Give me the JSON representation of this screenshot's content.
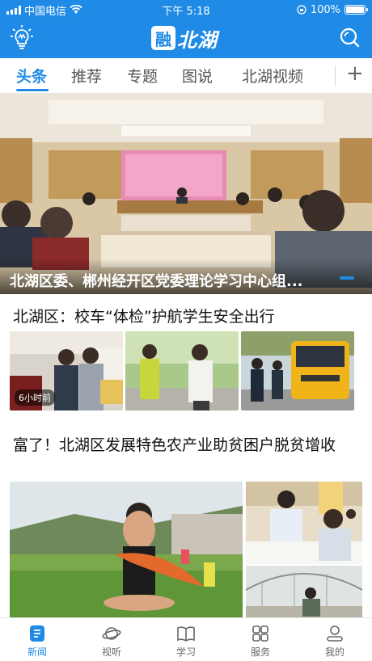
{
  "status_bar": {
    "carrier": "中国电信",
    "time": "下午 5:18",
    "battery": "100%"
  },
  "app": {
    "logo_badge": "融",
    "logo_text": "北湖",
    "accent_color": "#1f8be6",
    "icons": {
      "left": "lightbulb-icon",
      "right": "search-icon"
    }
  },
  "tabs": [
    {
      "label": "头条",
      "active": true
    },
    {
      "label": "推荐"
    },
    {
      "label": "专题"
    },
    {
      "label": "图说"
    },
    {
      "label": "北湖视频"
    }
  ],
  "add_tab_label": "+",
  "hero": {
    "caption": "北湖区委、郴州经开区党委理论学习中心组..."
  },
  "articles": [
    {
      "title": "北湖区：校车“体检”护航学生安全出行",
      "time": "6小时前"
    },
    {
      "title": "富了！北湖区发展特色农产业助贫困户脱贫增收"
    }
  ],
  "bottom_nav": [
    {
      "label": "新闻",
      "icon": "news-icon",
      "active": true
    },
    {
      "label": "视听",
      "icon": "planet-icon"
    },
    {
      "label": "学习",
      "icon": "book-icon"
    },
    {
      "label": "服务",
      "icon": "grid-icon"
    },
    {
      "label": "我的",
      "icon": "profile-icon"
    }
  ]
}
